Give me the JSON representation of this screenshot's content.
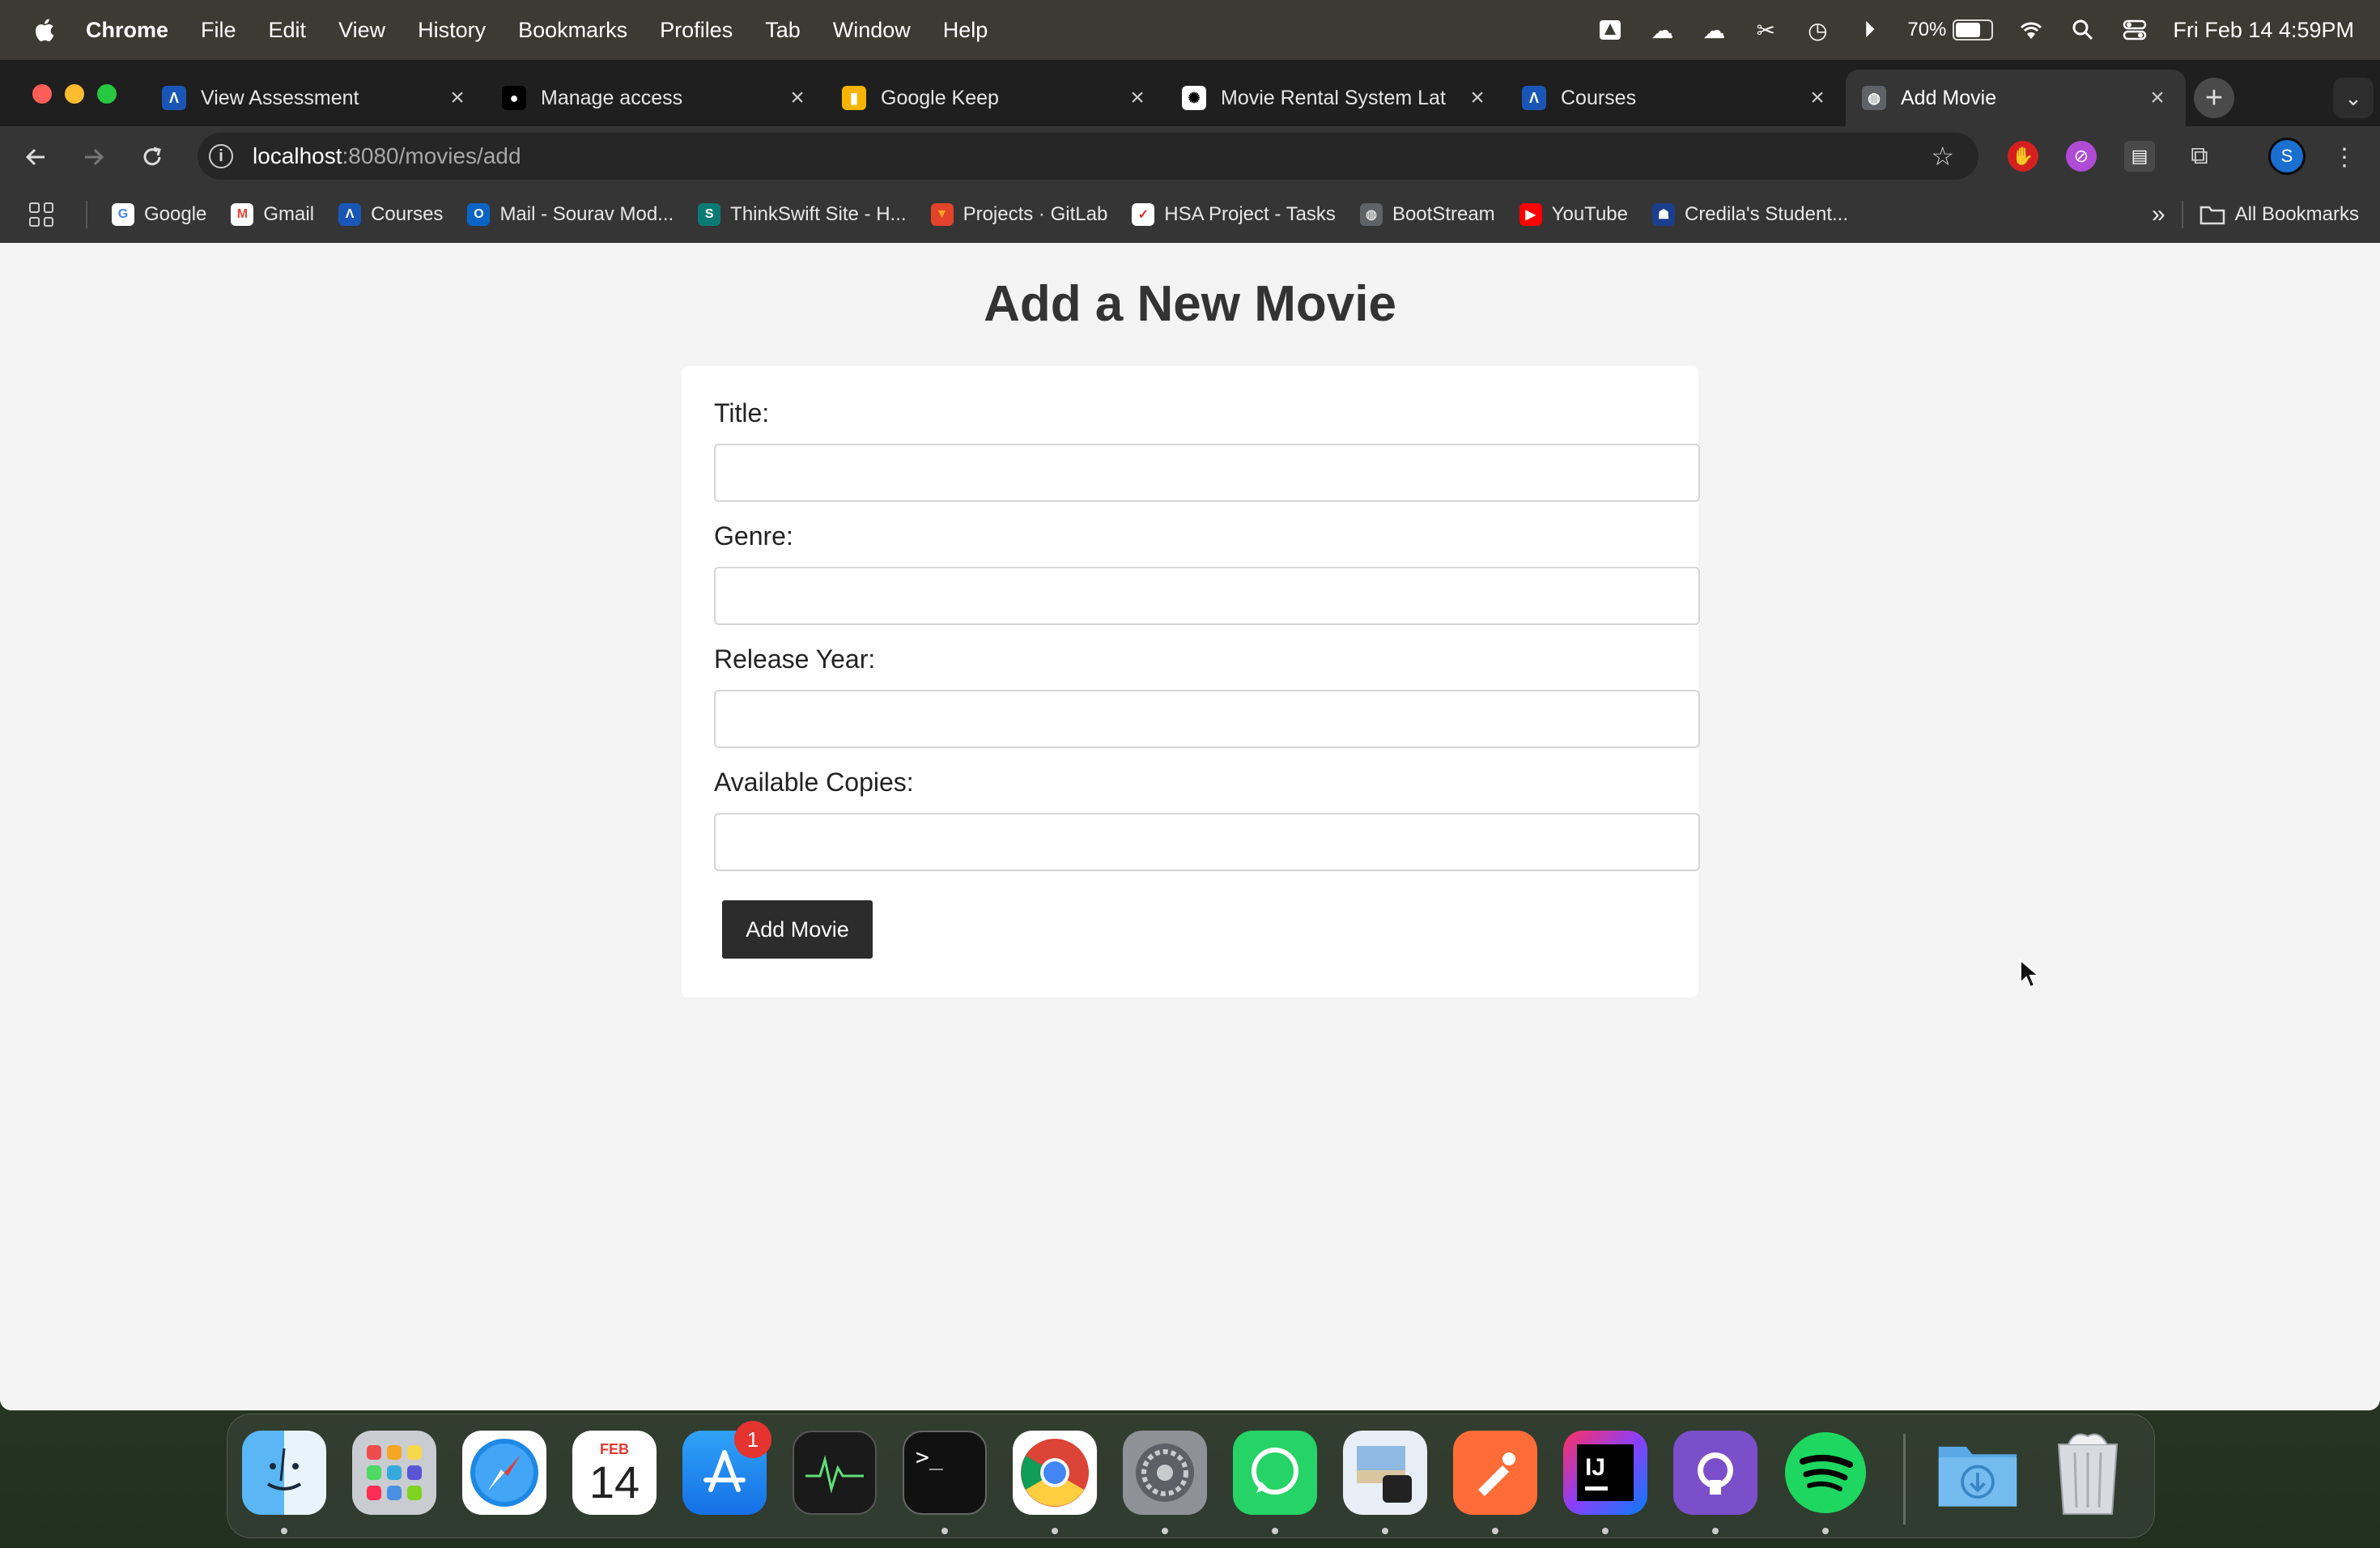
{
  "menubar": {
    "app_name": "Chrome",
    "items": [
      "File",
      "Edit",
      "View",
      "History",
      "Bookmarks",
      "Profiles",
      "Tab",
      "Window",
      "Help"
    ],
    "battery_percent": "70%",
    "datetime": "Fri Feb 14  4:59PM"
  },
  "tabs": [
    {
      "title": "View Assessment",
      "icon": "canvas-icon",
      "color": "#1a56b5",
      "glyph": "Λ"
    },
    {
      "title": "Manage access",
      "icon": "github-icon",
      "color": "#000000",
      "glyph": "●"
    },
    {
      "title": "Google Keep",
      "icon": "keep-icon",
      "color": "#f6b400",
      "glyph": "▮"
    },
    {
      "title": "Movie Rental System Lat",
      "icon": "openai-icon",
      "color": "#ffffff",
      "glyph": "✺"
    },
    {
      "title": "Courses",
      "icon": "canvas-icon",
      "color": "#1a56b5",
      "glyph": "Λ"
    },
    {
      "title": "Add Movie",
      "icon": "globe-icon",
      "color": "#5f6368",
      "glyph": "◍"
    }
  ],
  "address_bar": {
    "host": "localhost",
    "path": ":8080/movies/add"
  },
  "bookmarks": [
    {
      "label": "Google",
      "icon": "google-icon",
      "color": "#ffffff",
      "glyph": "G",
      "glyph_color": "#4285f4"
    },
    {
      "label": "Gmail",
      "icon": "gmail-icon",
      "color": "#ffffff",
      "glyph": "M",
      "glyph_color": "#ea4335"
    },
    {
      "label": "Courses",
      "icon": "canvas-icon",
      "color": "#1a56b5",
      "glyph": "Λ",
      "glyph_color": "#ffffff"
    },
    {
      "label": "Mail - Sourav Mod...",
      "icon": "outlook-icon",
      "color": "#0a64c8",
      "glyph": "O",
      "glyph_color": "#ffffff"
    },
    {
      "label": "ThinkSwift Site - H...",
      "icon": "sharepoint-icon",
      "color": "#0b7a75",
      "glyph": "S",
      "glyph_color": "#ffffff"
    },
    {
      "label": "Projects · GitLab",
      "icon": "gitlab-icon",
      "color": "#e2432a",
      "glyph": "▼",
      "glyph_color": "#fca326"
    },
    {
      "label": "HSA Project - Tasks",
      "icon": "tasks-icon",
      "color": "#ffffff",
      "glyph": "✓",
      "glyph_color": "#d93025"
    },
    {
      "label": "BootStream",
      "icon": "globe-icon",
      "color": "#5f6368",
      "glyph": "◍",
      "glyph_color": "#dddddd"
    },
    {
      "label": "YouTube",
      "icon": "youtube-icon",
      "color": "#ff0000",
      "glyph": "▶",
      "glyph_color": "#ffffff"
    },
    {
      "label": "Credila's Student...",
      "icon": "credila-icon",
      "color": "#1b3f8f",
      "glyph": "☗",
      "glyph_color": "#ffffff"
    }
  ],
  "bookmarks_right": {
    "overflow": "»",
    "all_bookmarks": "All Bookmarks"
  },
  "page": {
    "heading": "Add a New Movie",
    "fields": [
      {
        "label": "Title:",
        "value": "",
        "name": "title"
      },
      {
        "label": "Genre:",
        "value": "",
        "name": "genre"
      },
      {
        "label": "Release Year:",
        "value": "",
        "name": "release-year"
      },
      {
        "label": "Available Copies:",
        "value": "",
        "name": "available-copies"
      }
    ],
    "submit_label": "Add Movie"
  },
  "profile_initial": "S",
  "dock": {
    "calendar_month": "FEB",
    "calendar_day": "14",
    "appstore_badge": "1",
    "apps": [
      "finder-icon",
      "launchpad-icon",
      "safari-icon",
      "calendar-icon",
      "app-store-icon",
      "activity-monitor-icon",
      "terminal-icon",
      "chrome-icon",
      "system-settings-icon",
      "whatsapp-icon",
      "preview-icon",
      "postman-icon",
      "intellij-icon",
      "github-desktop-icon",
      "spotify-icon",
      "downloads-folder-icon",
      "trash-icon"
    ]
  }
}
